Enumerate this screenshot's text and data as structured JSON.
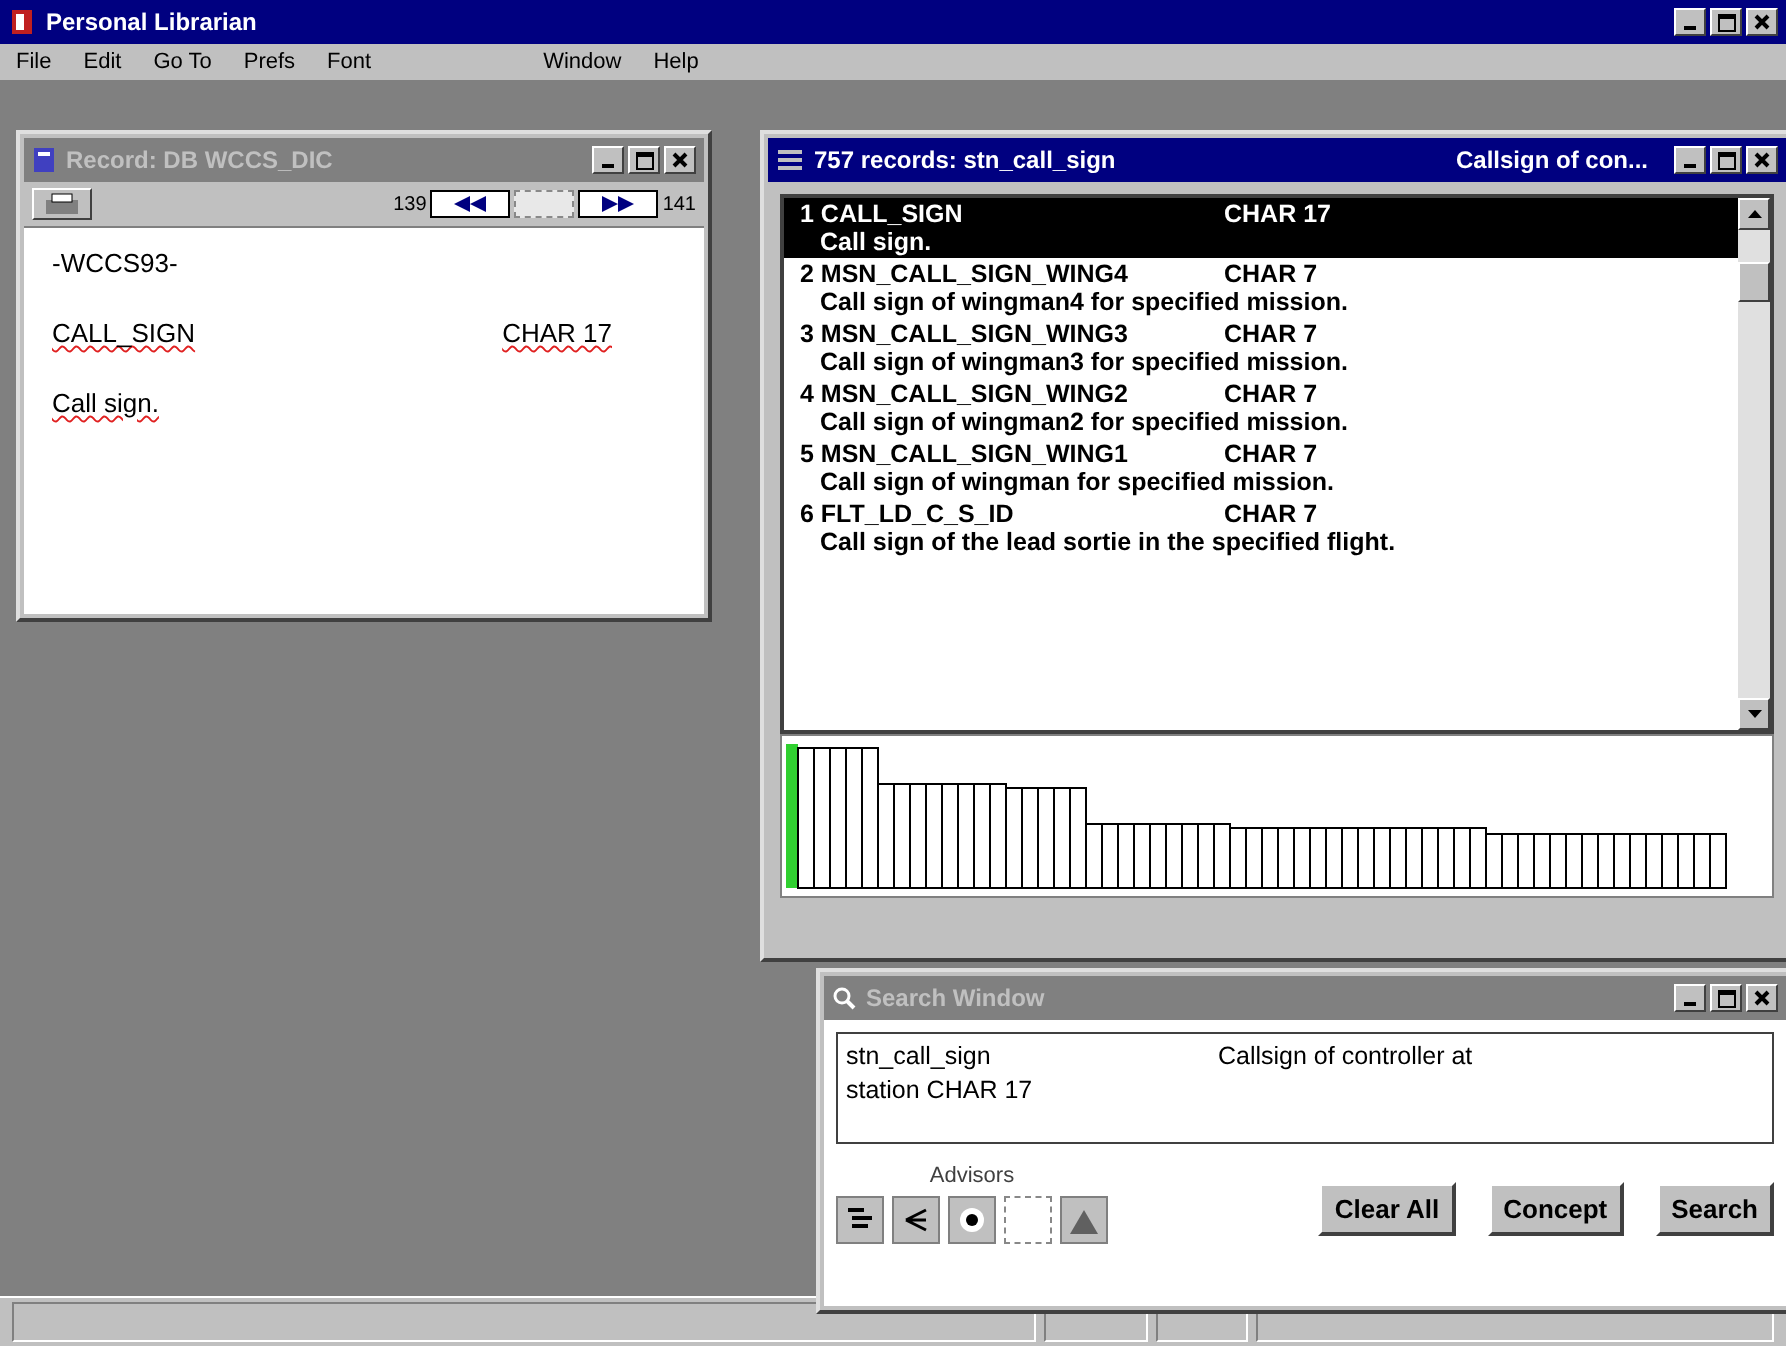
{
  "window": {
    "title": "Personal Librarian"
  },
  "menu": [
    {
      "label": "File",
      "disabled": false
    },
    {
      "label": "Edit",
      "disabled": false
    },
    {
      "label": "Go To",
      "disabled": false
    },
    {
      "label": "Prefs",
      "disabled": false
    },
    {
      "label": "Font",
      "disabled": false
    },
    {
      "label": "Window",
      "disabled": false
    },
    {
      "label": "Help",
      "disabled": false
    }
  ],
  "record_window": {
    "title": "Record:   DB WCCS_DIC",
    "counter_prev": "139",
    "counter_next": "141",
    "db_name": "-WCCS93-",
    "field_name": "CALL_SIGN",
    "field_type": "CHAR 17",
    "description": "Call sign."
  },
  "records_window": {
    "title": "757 records: stn_call_sign",
    "subtitle": "Callsign of con...",
    "records": [
      {
        "name": "1 CALL_SIGN",
        "type": "CHAR 17",
        "description": "Call sign.",
        "selected": true
      },
      {
        "name": "2 MSN_CALL_SIGN_WING4",
        "type": "CHAR 7",
        "description": "Call sign of wingman4 for specified mission.",
        "selected": false
      },
      {
        "name": "3 MSN_CALL_SIGN_WING3",
        "type": "CHAR 7",
        "description": "Call sign of wingman3 for specified mission.",
        "selected": false
      },
      {
        "name": "4 MSN_CALL_SIGN_WING2",
        "type": "CHAR 7",
        "description": "Call sign of wingman2 for specified mission.",
        "selected": false
      },
      {
        "name": "5 MSN_CALL_SIGN_WING1",
        "type": "CHAR 7",
        "description": "Call sign of wingman for specified mission.",
        "selected": false
      },
      {
        "name": "6 FLT_LD_C_S_ID",
        "type": "CHAR 7",
        "description": "Call sign of the lead sortie in the specified flight.",
        "selected": false
      }
    ]
  },
  "search_window": {
    "title": "Search Window",
    "query_name": "stn_call_sign",
    "query_description": "Callsign of controller at",
    "query_continuation": "station CHAR 17",
    "advisors_label": "Advisors",
    "buttons": [
      "Clear All",
      "Concept",
      "Search"
    ]
  }
}
